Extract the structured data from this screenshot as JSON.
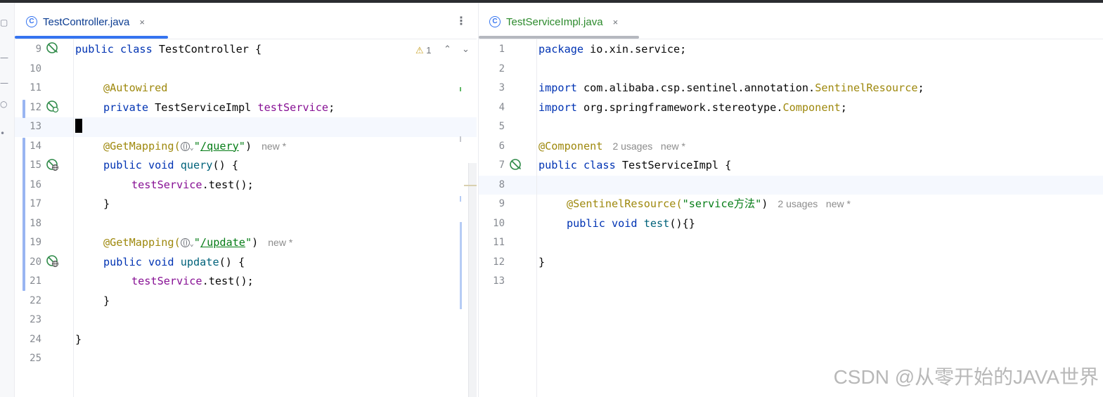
{
  "left_editor": {
    "tab_label": "TestController.java",
    "tab_icon": "class-icon",
    "close_glyph": "×",
    "more_glyph": "⋮",
    "warning_glyph": "⚠",
    "warning_count": "1",
    "nav_up_glyph": "⌃",
    "nav_down_glyph": "⌄",
    "line_numbers": [
      "9",
      "10",
      "11",
      "12",
      "13",
      "14",
      "15",
      "16",
      "17",
      "18",
      "19",
      "20",
      "21",
      "22",
      "23",
      "24",
      "25"
    ],
    "code": {
      "l9_kw": "public class ",
      "l9_name": "TestController {",
      "l11_ann": "@Autowired",
      "l12_kw": "private ",
      "l12_type": "TestServiceImpl ",
      "l12_field": "testService",
      "l12_end": ";",
      "l14_ann": "@GetMapping(",
      "l14_str_open": "\"",
      "l14_path": "/query",
      "l14_str_close": "\"",
      "l14_end": ")",
      "l14_hint": "new *",
      "l15_kw": "public void ",
      "l15_mth": "query",
      "l15_end": "() {",
      "l16_field": "testService",
      "l16_end": ".test();",
      "l17": "}",
      "l19_ann": "@GetMapping(",
      "l19_str_open": "\"",
      "l19_path": "/update",
      "l19_str_close": "\"",
      "l19_end": ")",
      "l19_hint": "new *",
      "l20_kw": "public void ",
      "l20_mth": "update",
      "l20_end": "() {",
      "l21_field": "testService",
      "l21_end": ".test();",
      "l22": "}",
      "l24": "}"
    }
  },
  "right_editor": {
    "tab_label": "TestServiceImpl.java",
    "tab_icon": "class-icon",
    "close_glyph": "×",
    "line_numbers": [
      "1",
      "2",
      "3",
      "4",
      "5",
      "6",
      "7",
      "8",
      "9",
      "10",
      "11",
      "12",
      "13"
    ],
    "code": {
      "l1_kw": "package ",
      "l1_rest": "io.xin.service;",
      "l3_kw": "import ",
      "l3_pkg": "com.alibaba.csp.sentinel.annotation.",
      "l3_cls": "SentinelResource",
      "l3_end": ";",
      "l4_kw": "import ",
      "l4_pkg": "org.springframework.stereotype.",
      "l4_cls": "Component",
      "l4_end": ";",
      "l6_ann": "@Component",
      "l6_hint": "2 usages   new *",
      "l7_kw": "public class ",
      "l7_name": "TestServiceImpl {",
      "l9_ann": "@SentinelResource(",
      "l9_str": "\"service方法\"",
      "l9_end": ")",
      "l9_hint": "2 usages   new *",
      "l10_kw": "public void ",
      "l10_mth": "test",
      "l10_end": "(){}",
      "l12": "}"
    }
  },
  "watermark": "CSDN @从零开始的JAVA世界",
  "colors": {
    "keyword": "#0033b3",
    "annotation": "#9e880d",
    "field": "#871094",
    "method": "#00627a",
    "string": "#067d17",
    "line_number": "#868a91",
    "accent": "#3574f0",
    "current_line": "#f5f8fe",
    "bean_icon": "#2e8a48"
  }
}
